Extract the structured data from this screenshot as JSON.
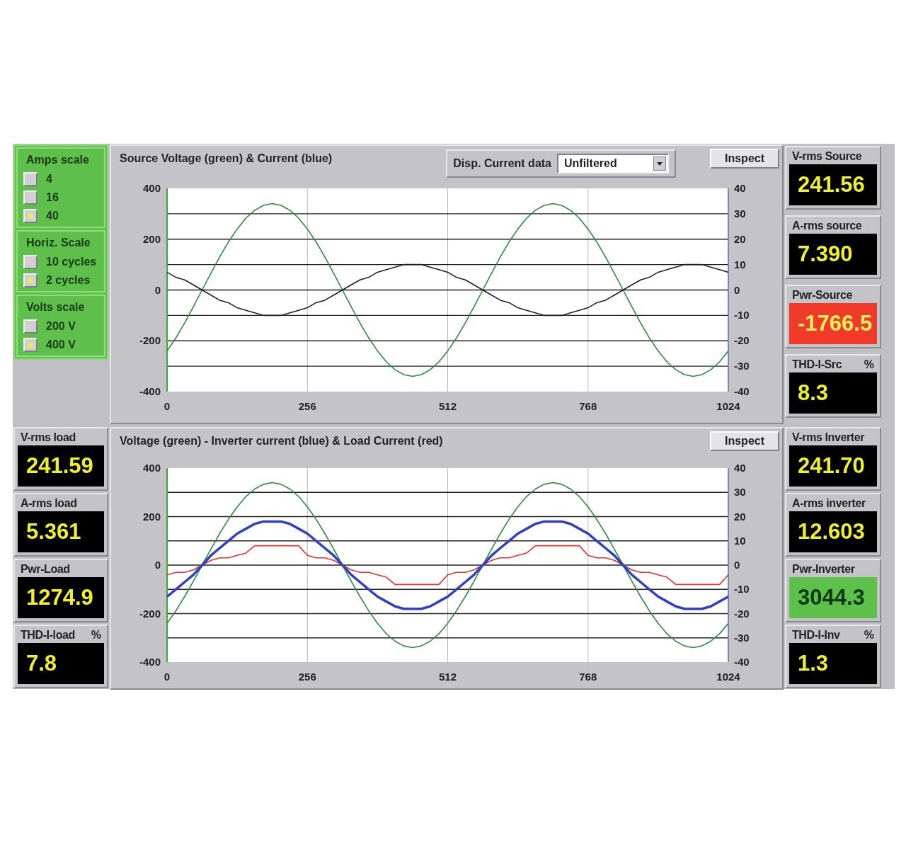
{
  "scale_groups": [
    {
      "title": "Amps scale",
      "options": [
        {
          "label": "4",
          "selected": false
        },
        {
          "label": "16",
          "selected": false
        },
        {
          "label": "40",
          "selected": true
        }
      ]
    },
    {
      "title": "Horiz. Scale",
      "options": [
        {
          "label": "10 cycles",
          "selected": false
        },
        {
          "label": "2 cycles",
          "selected": true
        }
      ]
    },
    {
      "title": "Volts scale",
      "options": [
        {
          "label": "200 V",
          "selected": false
        },
        {
          "label": "400 V",
          "selected": true
        }
      ]
    }
  ],
  "charts": [
    {
      "title": "Source Voltage (green) & Current (blue)",
      "dropdown": {
        "label": "Disp. Current data",
        "value": "Unfiltered"
      },
      "button": "Inspect",
      "chart_data": {
        "type": "line",
        "grid": true,
        "xlim": [
          0,
          1024
        ],
        "ylim": [
          -400,
          400
        ],
        "y2lim": [
          -40,
          40
        ],
        "xticks": [
          0,
          256,
          512,
          768,
          1024
        ],
        "yticks": [
          400,
          200,
          0,
          -200,
          -400
        ],
        "y2ticks": [
          40,
          30,
          20,
          10,
          0,
          -10,
          -20,
          -30,
          -40
        ],
        "x": [
          0,
          16,
          32,
          48,
          64,
          80,
          96,
          112,
          128,
          144,
          160,
          176,
          192,
          208,
          224,
          240,
          256,
          272,
          288,
          304,
          320,
          336,
          352,
          368,
          384,
          400,
          416,
          432,
          448,
          464,
          480,
          496,
          512,
          528,
          544,
          560,
          576,
          592,
          608,
          624,
          640,
          656,
          672,
          688,
          704,
          720,
          736,
          752,
          768,
          784,
          800,
          816,
          832,
          848,
          864,
          880,
          896,
          912,
          928,
          944,
          960,
          976,
          992,
          1008,
          1024
        ],
        "series": [
          {
            "color": "#2e8b3a",
            "values": [
              -240,
              -189,
              -130,
              -66,
              0,
              66,
              130,
              189,
              240,
              283,
              314,
              333,
              340,
              333,
              314,
              283,
              240,
              189,
              130,
              66,
              0,
              -66,
              -130,
              -189,
              -240,
              -283,
              -314,
              -333,
              -340,
              -333,
              -314,
              -283,
              -240,
              -189,
              -130,
              -66,
              0,
              66,
              130,
              189,
              240,
              283,
              314,
              333,
              340,
              333,
              314,
              283,
              240,
              189,
              130,
              66,
              0,
              -66,
              -130,
              -189,
              -240,
              -283,
              -314,
              -333,
              -340,
              -333,
              -314,
              -283,
              -240
            ]
          },
          {
            "color": "#202020",
            "axis": "y2",
            "values": [
              7,
              5,
              4,
              2,
              0,
              -2,
              -4,
              -5,
              -7,
              -8,
              -9,
              -10,
              -10,
              -10,
              -9,
              -8,
              -7,
              -5,
              -4,
              -2,
              0,
              2,
              4,
              5,
              7,
              8,
              9,
              10,
              10,
              10,
              9,
              8,
              7,
              5,
              4,
              2,
              0,
              -2,
              -4,
              -5,
              -7,
              -8,
              -9,
              -10,
              -10,
              -10,
              -9,
              -8,
              -7,
              -5,
              -4,
              -2,
              0,
              2,
              4,
              5,
              7,
              8,
              9,
              10,
              10,
              10,
              9,
              8,
              7
            ]
          }
        ]
      }
    },
    {
      "title": "Voltage (green) - Inverter current (blue) & Load Current (red)",
      "button": "Inspect",
      "chart_data": {
        "type": "line",
        "grid": true,
        "xlim": [
          0,
          1024
        ],
        "ylim": [
          -400,
          400
        ],
        "y2lim": [
          -40,
          40
        ],
        "xticks": [
          0,
          256,
          512,
          768,
          1024
        ],
        "yticks": [
          400,
          200,
          0,
          -200,
          -400
        ],
        "y2ticks": [
          40,
          30,
          20,
          10,
          0,
          -10,
          -20,
          -30,
          -40
        ],
        "x": [
          0,
          16,
          32,
          48,
          64,
          80,
          96,
          112,
          128,
          144,
          160,
          176,
          192,
          208,
          224,
          240,
          256,
          272,
          288,
          304,
          320,
          336,
          352,
          368,
          384,
          400,
          416,
          432,
          448,
          464,
          480,
          496,
          512,
          528,
          544,
          560,
          576,
          592,
          608,
          624,
          640,
          656,
          672,
          688,
          704,
          720,
          736,
          752,
          768,
          784,
          800,
          816,
          832,
          848,
          864,
          880,
          896,
          912,
          928,
          944,
          960,
          976,
          992,
          1008,
          1024
        ],
        "series": [
          {
            "color": "#2e8b3a",
            "values": [
              -240,
              -189,
              -130,
              -66,
              0,
              66,
              130,
              189,
              240,
              283,
              314,
              333,
              340,
              333,
              314,
              283,
              240,
              189,
              130,
              66,
              0,
              -66,
              -130,
              -189,
              -240,
              -283,
              -314,
              -333,
              -340,
              -333,
              -314,
              -283,
              -240,
              -189,
              -130,
              -66,
              0,
              66,
              130,
              189,
              240,
              283,
              314,
              333,
              340,
              333,
              314,
              283,
              240,
              189,
              130,
              66,
              0,
              -66,
              -130,
              -189,
              -240,
              -283,
              -314,
              -333,
              -340,
              -333,
              -314,
              -283,
              -240
            ]
          },
          {
            "color": "#e8302c",
            "axis": "y2",
            "values": [
              -4,
              -3,
              -3,
              -2,
              0,
              2,
              3,
              3,
              4,
              5,
              8,
              8,
              8,
              8,
              8,
              8,
              4,
              3,
              3,
              2,
              0,
              -2,
              -3,
              -3,
              -4,
              -5,
              -8,
              -8,
              -8,
              -8,
              -8,
              -8,
              -4,
              -3,
              -3,
              -2,
              0,
              2,
              3,
              3,
              4,
              5,
              8,
              8,
              8,
              8,
              8,
              8,
              4,
              3,
              3,
              2,
              0,
              -2,
              -3,
              -3,
              -4,
              -5,
              -8,
              -8,
              -8,
              -8,
              -8,
              -8,
              -4
            ]
          },
          {
            "color": "#3040c0",
            "axis": "y2",
            "values": [
              -13,
              -10,
              -7,
              -4,
              0,
              4,
              7,
              10,
              13,
              15,
              17,
              18,
              18,
              18,
              17,
              15,
              13,
              10,
              7,
              4,
              0,
              -4,
              -7,
              -10,
              -13,
              -15,
              -17,
              -18,
              -18,
              -18,
              -17,
              -15,
              -13,
              -10,
              -7,
              -4,
              0,
              4,
              7,
              10,
              13,
              15,
              17,
              18,
              18,
              18,
              17,
              15,
              13,
              10,
              7,
              4,
              0,
              -4,
              -7,
              -10,
              -13,
              -15,
              -17,
              -18,
              -18,
              -18,
              -17,
              -15,
              -13
            ]
          }
        ]
      }
    }
  ],
  "left_meters": [
    {
      "label": "V-rms load",
      "value": "241.59",
      "kind": "normal"
    },
    {
      "label": "A-rms load",
      "value": "5.361",
      "kind": "normal"
    },
    {
      "label": "Pwr-Load",
      "value": "1274.9",
      "kind": "normal"
    },
    {
      "label": "THD-I-load",
      "unit": "%",
      "value": "7.8",
      "kind": "normal"
    }
  ],
  "right_meters_top": [
    {
      "label": "V-rms Source",
      "value": "241.56",
      "kind": "normal"
    },
    {
      "label": "A-rms source",
      "value": "7.390",
      "kind": "normal"
    },
    {
      "label": "Pwr-Source",
      "value": "-1766.5",
      "kind": "alarm"
    },
    {
      "label": "THD-I-Src",
      "unit": "%",
      "value": "8.3",
      "kind": "normal"
    }
  ],
  "right_meters_bottom": [
    {
      "label": "V-rms Inverter",
      "value": "241.70",
      "kind": "normal"
    },
    {
      "label": "A-rms inverter",
      "value": "12.603",
      "kind": "normal"
    },
    {
      "label": "Pwr-Inverter",
      "value": "3044.3",
      "kind": "ok"
    },
    {
      "label": "THD-I-Inv",
      "unit": "%",
      "value": "1.3",
      "kind": "normal"
    }
  ]
}
